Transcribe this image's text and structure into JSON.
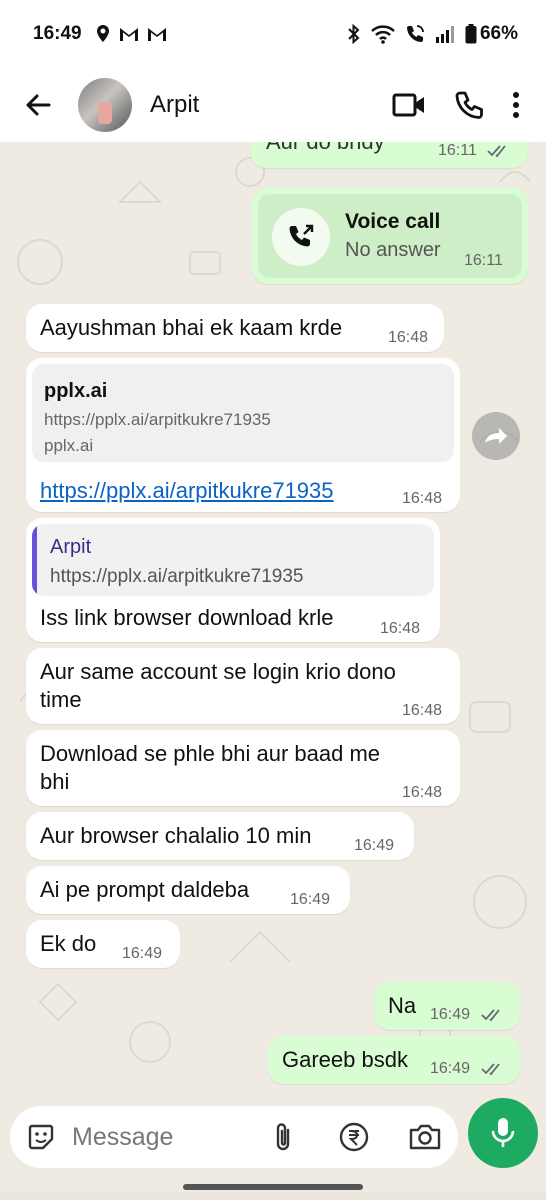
{
  "status_bar": {
    "time": "16:49",
    "battery": "66%",
    "left_icons": [
      "location-icon",
      "gmail-icon",
      "gmail-icon"
    ],
    "right_icons": [
      "bluetooth-icon",
      "wifi-icon",
      "wifi-call-icon",
      "signal-icon",
      "battery-icon"
    ]
  },
  "header": {
    "contact_name": "Arpit",
    "icons": [
      "back-arrow-icon",
      "video-call-icon",
      "phone-icon",
      "more-icon"
    ]
  },
  "messages": [
    {
      "type": "out",
      "text": "Aur do bhdy",
      "time": "16:11",
      "ticks": "read"
    },
    {
      "type": "call",
      "title": "Voice call",
      "subtitle": "No answer",
      "time": "16:11"
    },
    {
      "type": "in",
      "text": "Aayushman bhai ek kaam krde",
      "time": "16:48"
    },
    {
      "type": "in-link",
      "card_title": "pplx.ai",
      "card_url": "https://pplx.ai/arpitkukre71935",
      "card_domain": "pplx.ai",
      "link": "https://pplx.ai/arpitkukre71935",
      "time": "16:48"
    },
    {
      "type": "in-reply",
      "quote_author": "Arpit",
      "quote_text": "https://pplx.ai/arpitkukre71935",
      "text": "Iss link browser download krle",
      "time": "16:48"
    },
    {
      "type": "in",
      "text_line1": "Aur same account se login krio dono",
      "text_line2": "time",
      "time": "16:48"
    },
    {
      "type": "in",
      "text_line1": "Download se phle bhi aur baad me",
      "text_line2": "bhi",
      "time": "16:48"
    },
    {
      "type": "in",
      "text": "Aur browser chalalio 10 min",
      "time": "16:49"
    },
    {
      "type": "in",
      "text": "Ai pe prompt daldeba",
      "time": "16:49"
    },
    {
      "type": "in",
      "text": "Ek do",
      "time": "16:49"
    },
    {
      "type": "out",
      "text": "Na",
      "time": "16:49",
      "ticks": "read"
    },
    {
      "type": "out",
      "text": "Gareeb bsdk",
      "time": "16:49",
      "ticks": "read"
    }
  ],
  "input": {
    "placeholder": "Message",
    "icons": [
      "emoji-sticker-icon",
      "attach-icon",
      "rupee-payment-icon",
      "camera-icon",
      "mic-icon"
    ]
  },
  "colors": {
    "outgoing_bubble": "#d9fdd3",
    "incoming_bubble": "#ffffff",
    "chat_background": "#efeae2",
    "link": "#0b63c5",
    "accent_green": "#1daa61",
    "quote_bar": "#6a4fdb"
  }
}
